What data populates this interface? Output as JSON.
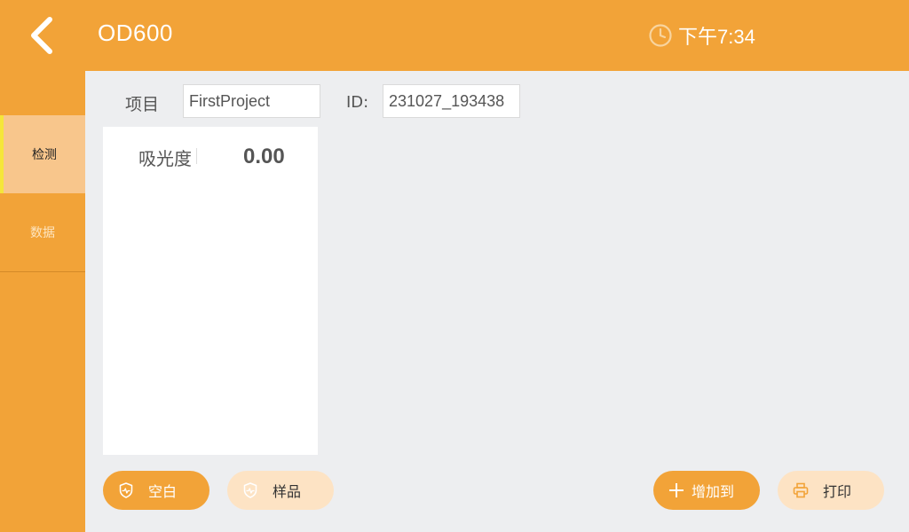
{
  "header": {
    "title": "OD600",
    "time": "下午7:34"
  },
  "sidebar": {
    "items": [
      {
        "label": "检测",
        "active": true
      },
      {
        "label": "数据",
        "active": false
      }
    ]
  },
  "form": {
    "project_label": "项目",
    "project_value": "FirstProject",
    "id_label": "ID:",
    "id_value": "231027_193438"
  },
  "measurement": {
    "label": "吸光度",
    "value": "0.00"
  },
  "buttons": {
    "blank": "空白",
    "sample": "样品",
    "add_to": "增加到",
    "print": "打印"
  },
  "colors": {
    "accent": "#f2a338",
    "accent_light": "#fde3c4",
    "active_nav": "#f8c68c",
    "active_marker": "#f5e63a",
    "background": "#edeef0"
  }
}
